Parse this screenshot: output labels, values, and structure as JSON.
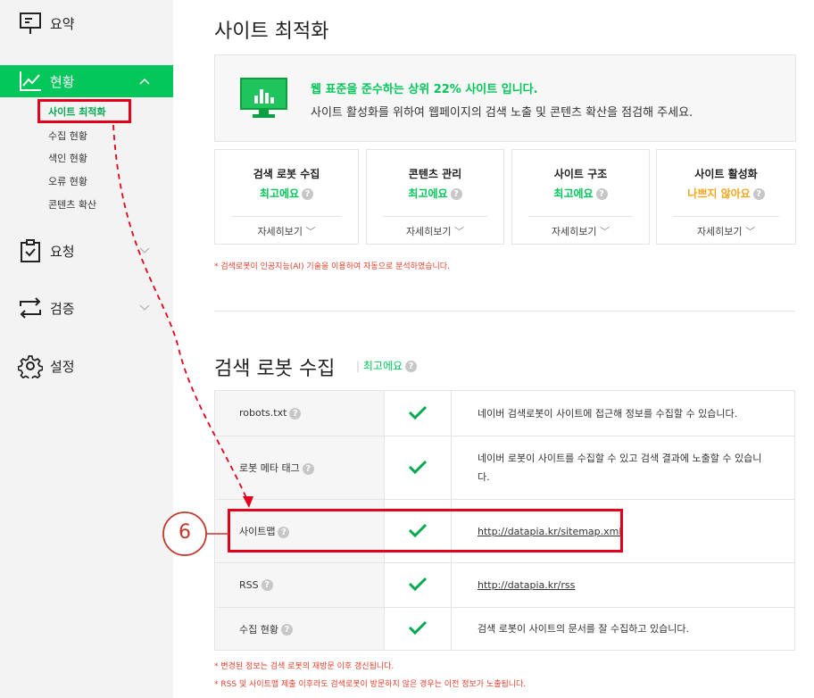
{
  "sidebar": {
    "summary": "요약",
    "status": "현황",
    "status_sub": [
      "사이트 최적화",
      "수집 현황",
      "색인 현황",
      "오류 현황",
      "콘텐츠 확산"
    ],
    "request": "요청",
    "verify": "검증",
    "settings": "설정"
  },
  "main": {
    "title": "사이트 최적화",
    "banner": {
      "headline": "웹 표준을 준수하는 상위 22% 사이트 입니다.",
      "description": "사이트 활성화를 위하여 웹페이지의 검색 노출 및 콘텐츠 확산을 점검해 주세요."
    },
    "cards": [
      {
        "title": "검색 로봇 수집",
        "status": "최고에요",
        "status_color": "#03c75a",
        "more": "자세히보기"
      },
      {
        "title": "콘텐츠 관리",
        "status": "최고에요",
        "status_color": "#03c75a",
        "more": "자세히보기"
      },
      {
        "title": "사이트 구조",
        "status": "최고에요",
        "status_color": "#03c75a",
        "more": "자세히보기"
      },
      {
        "title": "사이트 활성화",
        "status": "나쁘지 않아요",
        "status_color": "#f5a623",
        "more": "자세히보기"
      }
    ],
    "cards_note": "* 검색로봇이 인공지능(AI) 기술을 이용하여 자동으로 분석하였습니다.",
    "robots_section": {
      "title": "검색 로봇 수집",
      "status": "최고에요",
      "rows": [
        {
          "name": "robots.txt",
          "desc": "네이버 검색로봇이 사이트에 접근해 정보를 수집할 수 있습니다."
        },
        {
          "name": "로봇 메타 태그",
          "desc": "네이버 로봇이 사이트를 수집할 수 있고 검색 결과에 노출할 수 있습니다."
        },
        {
          "name": "사이트맵",
          "desc": "http://datapia.kr/sitemap.xml"
        },
        {
          "name": "RSS",
          "desc": "http://datapia.kr/rss"
        },
        {
          "name": "수집 현황",
          "desc": "검색 로봇이 사이트의 문서를 잘 수집하고 있습니다."
        }
      ],
      "notes": [
        "* 변경된 정보는 검색 로봇의 재방문 이후 갱신됩니다.",
        "* RSS 및 사이트맵 제출 이후라도 검색로봇이 방문하지 않은 경우는 이전 정보가 노출됩니다."
      ]
    },
    "help_glyph": "?"
  },
  "annotation": {
    "number": "6",
    "color": "#e2001a"
  }
}
